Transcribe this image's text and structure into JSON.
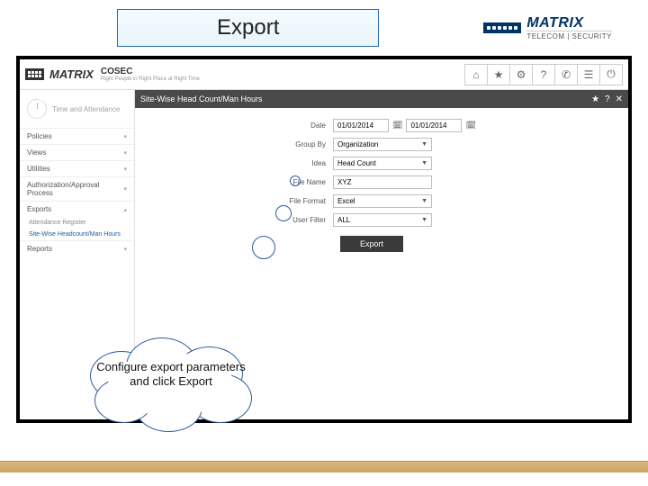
{
  "slide": {
    "title": "Export",
    "brand_name": "MATRIX",
    "brand_sub": "TELECOM | SECURITY"
  },
  "app": {
    "brand": "MATRIX",
    "product": "COSEC",
    "tagline": "Right People in Right Place at Right Time",
    "topbar_icons": [
      "home-icon",
      "star-icon",
      "gear-icon",
      "help-icon",
      "phone-icon",
      "users-icon",
      "power-icon"
    ]
  },
  "sidebar": {
    "module": "Time and Attendance",
    "groups": [
      {
        "label": "Policies"
      },
      {
        "label": "Views"
      },
      {
        "label": "Utilities"
      },
      {
        "label": "Authorization/Approval Process"
      },
      {
        "label": "Exports",
        "children": [
          {
            "label": "Attendance Register"
          },
          {
            "label": "Site-Wise Headcount/Man Hours",
            "active": true
          }
        ]
      },
      {
        "label": "Reports"
      }
    ]
  },
  "panel": {
    "title": "Site-Wise Head Count/Man Hours",
    "icons": [
      "star",
      "help",
      "close"
    ]
  },
  "form": {
    "date_label": "Date",
    "date_from": "01/01/2014",
    "date_to": "01/01/2014",
    "group_by_label": "Group By",
    "group_by_value": "Organization",
    "idea_label": "Idea",
    "idea_value": "Head Count",
    "filename_label": "File Name",
    "filename_value": "XYZ",
    "fileformat_label": "File Format",
    "fileformat_value": "Excel",
    "userfilter_label": "User Filter",
    "userfilter_value": "ALL",
    "export_button": "Export"
  },
  "callout": {
    "text": "Configure export parameters and click Export"
  }
}
